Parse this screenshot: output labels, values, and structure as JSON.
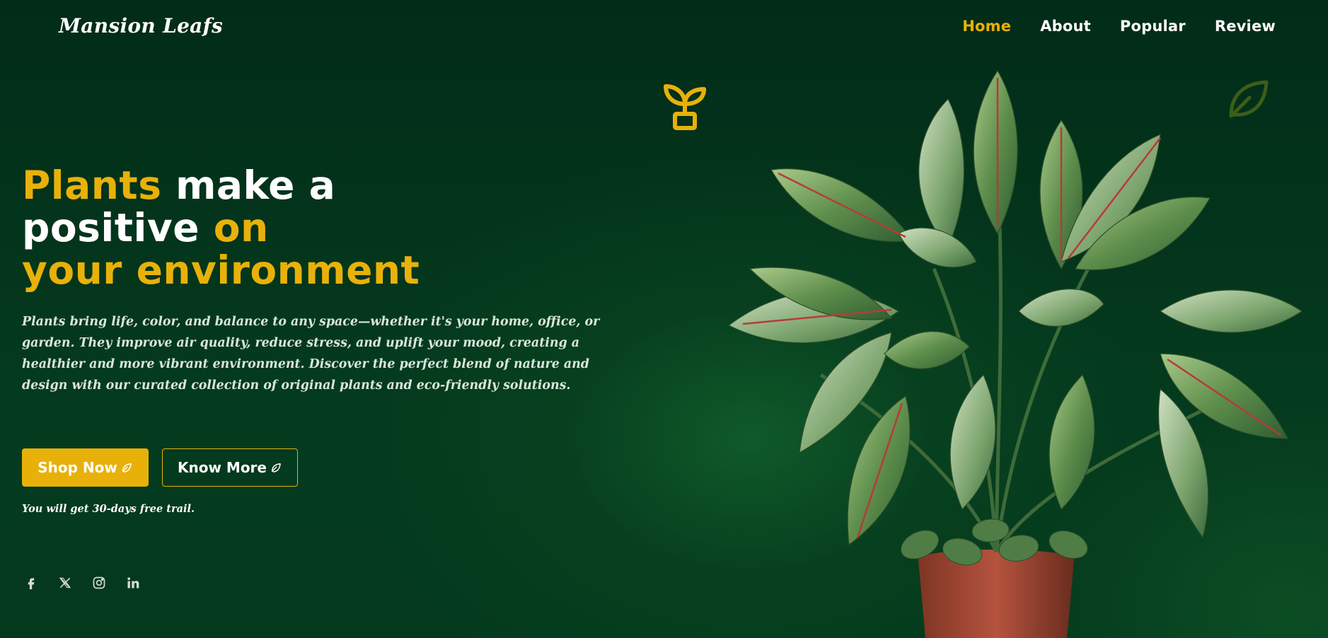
{
  "header": {
    "logo": "Mansion Leafs",
    "nav": [
      {
        "label": "Home",
        "active": true
      },
      {
        "label": "About",
        "active": false
      },
      {
        "label": "Popular",
        "active": false
      },
      {
        "label": "Review",
        "active": false
      }
    ]
  },
  "hero": {
    "title": {
      "line1_highlight": "Plants",
      "line1_rest": " make a",
      "line2_start": "positive ",
      "line2_highlight": "on",
      "line3_highlight": "your environment"
    },
    "description": "Plants bring life, color, and balance to any space—whether it's your home, office, or garden. They improve air quality, reduce stress, and uplift your mood, creating a healthier and more vibrant environment. Discover the perfect blend of nature and design with our curated collection of original plants and eco-friendly solutions.",
    "buttons": {
      "shop": "Shop Now",
      "know": "Know More"
    },
    "trial_note": "You will get 30-days free trail."
  },
  "social": {
    "icons": [
      "facebook-icon",
      "x-icon",
      "instagram-icon",
      "linkedin-icon"
    ]
  },
  "decor": {
    "icons": [
      "plant-pot-icon",
      "leaf-icon"
    ]
  },
  "colors": {
    "background": "#03301a",
    "accent": "#e8b10a",
    "text": "#ffffff",
    "pot": "#b5533e"
  }
}
